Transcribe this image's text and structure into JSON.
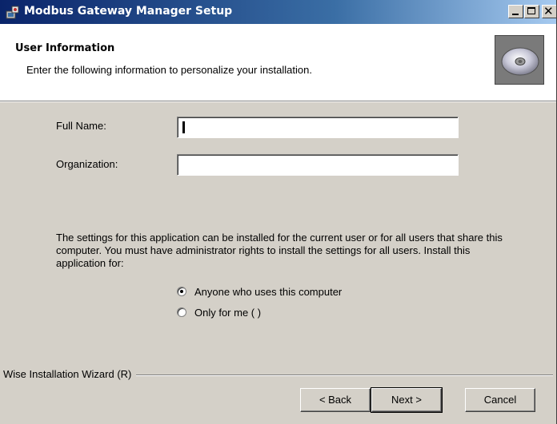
{
  "window": {
    "title": "Modbus Gateway Manager Setup",
    "icon": "setup-icon",
    "controls": [
      "minimize",
      "maximize",
      "close"
    ]
  },
  "header": {
    "title": "User Information",
    "subtitle": "Enter the following information to personalize your installation.",
    "icon": "cd-disc-icon"
  },
  "form": {
    "full_name_label": "Full Name:",
    "full_name_value": "",
    "organization_label": "Organization:",
    "organization_value": ""
  },
  "install_scope": {
    "description": "The settings for this application can be installed for the current user or for all users that share this computer. You must have administrator rights to install the settings for all users. Install this application for:",
    "options": [
      {
        "label": "Anyone who uses this computer",
        "selected": true
      },
      {
        "label": "Only for me ( )",
        "selected": false
      }
    ]
  },
  "footer": {
    "wizard_label": "Wise Installation Wizard (R)",
    "back_label": "< Back",
    "next_label": "Next >",
    "cancel_label": "Cancel"
  },
  "colors": {
    "titlebar_start": "#0a246a",
    "titlebar_end": "#a6caf0",
    "dialog_face": "#d4d0c8",
    "banner": "#ffffff"
  }
}
